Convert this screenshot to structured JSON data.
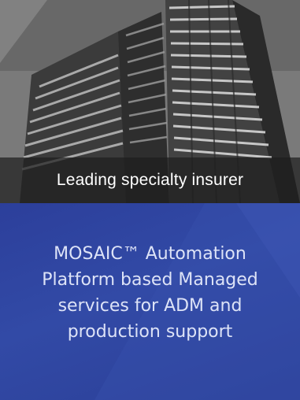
{
  "card": {
    "image_icon": "office-tower-photo",
    "caption": "Leading specialty insurer",
    "description_lines": [
      "MOSAIC™ Automation",
      "Platform based Managed",
      "services for ADM and",
      "production support"
    ]
  },
  "colors": {
    "panel_blue": "#2f44a0",
    "caption_overlay": "#1e1e1e",
    "text_white": "#ffffff"
  }
}
